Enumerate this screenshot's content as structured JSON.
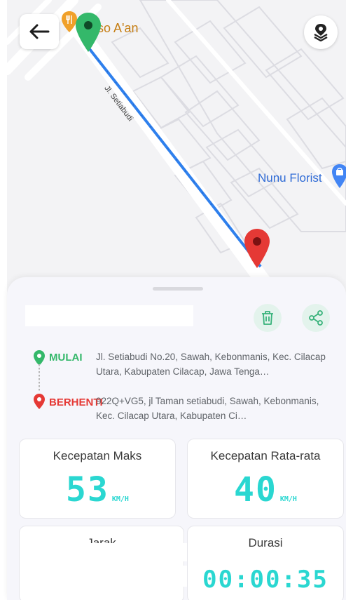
{
  "map": {
    "poi_name": "kso A'an",
    "florist_name": "Nunu Florist",
    "road_name": "Jl. Setiabudi"
  },
  "trip": {
    "start_label": "MULAI",
    "start_address": "Jl. Setiabudi No.20, Sawah, Kebonmanis, Kec. Cilacap Utara, Kabupaten Cilacap, Jawa Tenga…",
    "stop_label": "BERHENTI",
    "stop_address": "922Q+VG5, jl Taman setiabudi, Sawah, Kebonmanis, Kec. Cilacap Utara, Kabupaten Ci…"
  },
  "stats": {
    "max_speed_title": "Kecepatan Maks",
    "max_speed_value": "53",
    "max_speed_unit": "KM/H",
    "avg_speed_title": "Kecepatan Rata-rata",
    "avg_speed_value": "40",
    "avg_speed_unit": "KM/H",
    "distance_title": "Jarak",
    "duration_title": "Durasi",
    "duration_value": "00:00:35"
  },
  "colors": {
    "start_green": "#34b86a",
    "stop_red": "#e53935",
    "route_blue": "#2f80ed",
    "lcd_cyan": "#2ad7d1"
  },
  "icons": [
    "back-arrow-icon",
    "layers-icon",
    "restaurant-pin-icon",
    "start-pin-icon",
    "end-pin-icon",
    "shopping-pin-icon",
    "trash-icon",
    "share-icon"
  ]
}
